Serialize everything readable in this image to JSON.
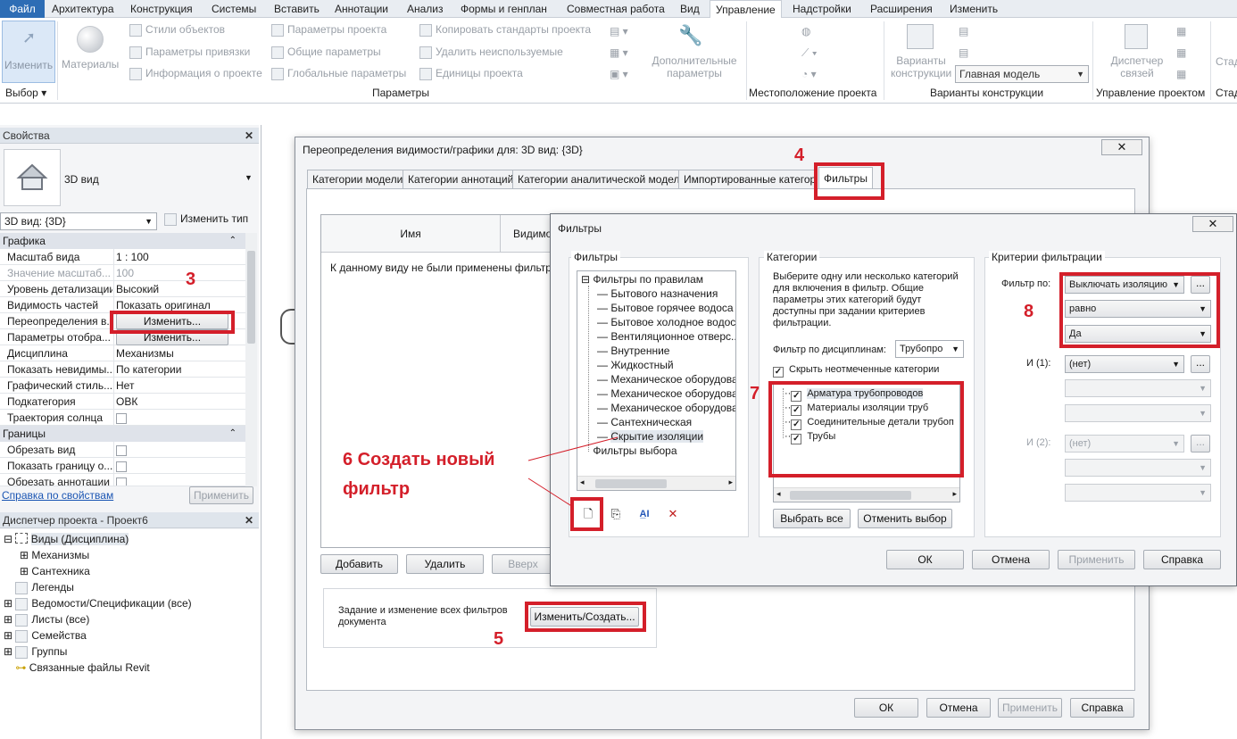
{
  "menu": {
    "file": "Файл",
    "tabs": [
      "Архитектура",
      "Конструкция",
      "Системы",
      "Вставить",
      "Аннотации",
      "Анализ",
      "Формы и генплан",
      "Совместная работа",
      "Вид",
      "Управление",
      "Надстройки",
      "Расширения",
      "Изменить"
    ]
  },
  "ribbon": {
    "modify": "Изменить",
    "materials": "Материалы",
    "col1": [
      "Стили объектов",
      "Параметры привязки",
      "Информация о проекте"
    ],
    "col2": [
      "Параметры проекта",
      "Общие параметры",
      "Глобальные параметры"
    ],
    "col3": [
      "Копировать стандарты проекта",
      "Удалить неиспользуемые",
      "Единицы проекта"
    ],
    "extra_params": "Дополнительные параметры",
    "variants": "Варианты конструкции",
    "main_model": "Главная модель",
    "link_manager": "Диспетчер связей",
    "sta": "Стад",
    "groups": {
      "select": "Выбор",
      "params": "Параметры",
      "location": "Местоположение проекта",
      "variants": "Варианты конструкции",
      "management": "Управление проектом",
      "stad": "Стад"
    }
  },
  "properties": {
    "title": "Свойства",
    "type_name": "3D вид",
    "view_selector": "3D вид: {3D}",
    "edit_type": "Изменить тип",
    "section_graphics": "Графика",
    "rows": [
      {
        "k": "Масштаб вида",
        "v": "1 : 100"
      },
      {
        "k": "Значение масштаб...",
        "v": "100"
      },
      {
        "k": "Уровень детализации",
        "v": "Высокий"
      },
      {
        "k": "Видимость частей",
        "v": "Показать оригинал"
      },
      {
        "k": "Переопределения в...",
        "v": "Изменить..."
      },
      {
        "k": "Параметры отобра...",
        "v": "Изменить..."
      },
      {
        "k": "Дисциплина",
        "v": "Механизмы"
      },
      {
        "k": "Показать невидимы...",
        "v": "По категории"
      },
      {
        "k": "Графический стиль...",
        "v": "Нет"
      },
      {
        "k": "Подкатегория",
        "v": "ОВК"
      },
      {
        "k": "Траектория солнца",
        "v": ""
      }
    ],
    "section_bounds": "Границы",
    "bounds_rows": [
      "Обрезать вид",
      "Показать границу о...",
      "Обрезать аннотации"
    ],
    "help": "Справка по свойствам",
    "apply": "Применить"
  },
  "browser": {
    "title": "Диспетчер проекта - Проект6",
    "items": [
      "Виды (Дисциплина)",
      "Механизмы",
      "Сантехника",
      "Легенды",
      "Ведомости/Спецификации (все)",
      "Листы (все)",
      "Семейства",
      "Группы",
      "Связанные файлы Revit"
    ]
  },
  "vg_dialog": {
    "title": "Переопределения видимости/графики для: 3D вид: {3D}",
    "tabs": [
      "Категории модели",
      "Категории аннотаций",
      "Категории аналитической модели",
      "Импортированные категории",
      "Фильтры"
    ],
    "col_name": "Имя",
    "col_vis": "Видимо",
    "empty_msg": "К данному виду не были применены фильтры. Н",
    "add": "Добавить",
    "remove": "Удалить",
    "up": "Вверх",
    "note": "Задание и изменение всех фильтров документа",
    "edit_create": "Изменить/Создать...",
    "ok": "ОК",
    "cancel": "Отмена",
    "apply": "Применить",
    "help": "Справка"
  },
  "filters_dialog": {
    "title": "Фильтры",
    "filters_legend": "Фильтры",
    "tree_root": "Фильтры по правилам",
    "tree_items": [
      "Бытового назначения",
      "Бытовое горячее водоса",
      "Бытовое холодное водосн",
      "Вентиляционное отверс...",
      "Внутренние",
      "Жидкостный",
      "Механическое оборудова",
      "Механическое оборудова",
      "Механическое оборудова",
      "Сантехническая",
      "Скрытие изоляции"
    ],
    "tree_selection": "Фильтры выбора",
    "categories_legend": "Категории",
    "categories_desc": "Выберите одну или несколько категорий для включения в фильтр. Общие параметры этих категорий будут доступны при задании критериев фильтрации.",
    "discipline_label": "Фильтр по дисциплинам:",
    "discipline_value": "Трубопро",
    "hide_unchecked": "Скрыть неотмеченные категории",
    "categories": [
      "Арматура трубопроводов",
      "Материалы изоляции труб",
      "Соединительные детали трубоп",
      "Трубы"
    ],
    "select_all": "Выбрать все",
    "deselect": "Отменить выбор",
    "criteria_legend": "Критерии фильтрации",
    "filter_by": "Фильтр по:",
    "param": "Выключать изоляцию",
    "operator": "равно",
    "value": "Да",
    "and1": "И (1):",
    "and2": "И (2):",
    "none": "(нет)",
    "more": "...",
    "ok": "ОК",
    "cancel": "Отмена",
    "apply": "Применить",
    "help": "Справка"
  },
  "annotations": {
    "n3": "3",
    "n4": "4",
    "n5": "5",
    "n6a": "6 Создать новый",
    "n6b": "фильтр",
    "n7": "7",
    "n8": "8"
  }
}
